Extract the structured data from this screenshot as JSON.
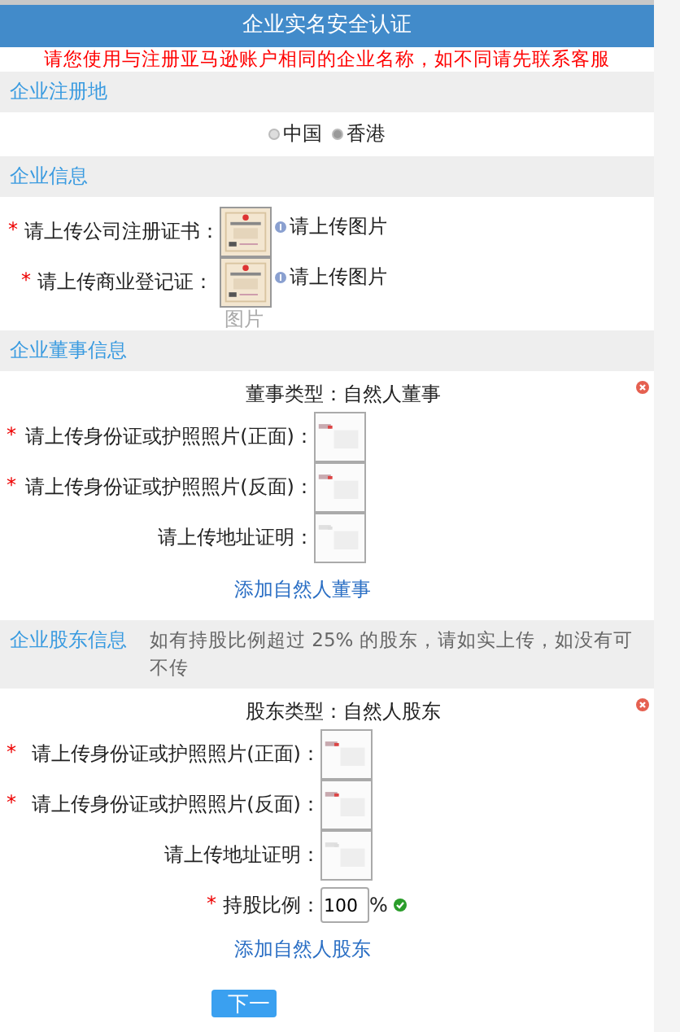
{
  "header": {
    "title": "企业实名安全认证"
  },
  "notice": "请您使用与注册亚马逊账户相同的企业名称，如不同请先联系客服",
  "registration": {
    "heading": "企业注册地",
    "options": [
      {
        "label": "中国",
        "selected": false
      },
      {
        "label": "香港",
        "selected": true
      }
    ]
  },
  "company": {
    "heading": "企业信息",
    "uploads": [
      {
        "mark": "*",
        "label": "请上传公司注册证书：",
        "hint": "请上传图片"
      },
      {
        "mark": "*",
        "label": "请上传商业登记证：",
        "hint": "请上传图片"
      }
    ],
    "caption": "图片"
  },
  "directors": {
    "heading": "企业董事信息",
    "type_label": "董事类型：",
    "type_value": "自然人董事",
    "uploads": [
      {
        "mark": "*",
        "label": "请上传身份证或护照照片(正面)："
      },
      {
        "mark": "*",
        "label": "请上传身份证或护照照片(反面)："
      },
      {
        "label": "请上传地址证明："
      }
    ],
    "add_link": "添加自然人董事"
  },
  "shareholders": {
    "heading": "企业股东信息",
    "note": "如有持股比例超过 25% 的股东，请如实上传，如没有可不传",
    "type_label": "股东类型：",
    "type_value": "自然人股东",
    "uploads": [
      {
        "mark": "*",
        "label": "请上传身份证或护照照片(正面)："
      },
      {
        "mark": "*",
        "label": "请上传身份证或护照照片(反面)："
      },
      {
        "label": "请上传地址证明："
      }
    ],
    "share": {
      "mark": "*",
      "label": "持股比例：",
      "value": "100",
      "unit": "%",
      "valid": true
    },
    "add_link": "添加自然人股东"
  },
  "next_button": "下一"
}
